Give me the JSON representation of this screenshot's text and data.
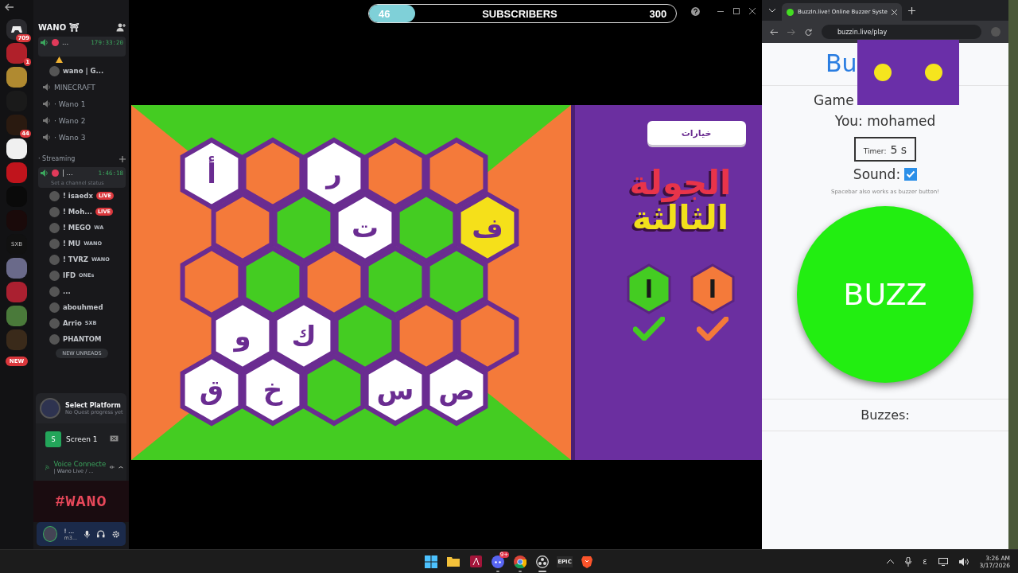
{
  "discord": {
    "rail": [
      {
        "kind": "home",
        "badge": "709"
      },
      {
        "kind": "server",
        "badge": "1"
      },
      {
        "kind": "server"
      },
      {
        "kind": "server"
      },
      {
        "kind": "server",
        "badge": "44"
      },
      {
        "kind": "server"
      },
      {
        "kind": "server"
      },
      {
        "kind": "server"
      },
      {
        "kind": "server"
      },
      {
        "kind": "server",
        "label": "SXB"
      },
      {
        "kind": "server"
      },
      {
        "kind": "server"
      },
      {
        "kind": "server"
      },
      {
        "kind": "server"
      }
    ],
    "new_pill": "NEW",
    "server_name": "WANO ⛩",
    "rows": [
      {
        "kind": "voice-active",
        "name": "...",
        "time": "179:33:20"
      },
      {
        "kind": "alert"
      },
      {
        "kind": "member",
        "name": "wano | G..."
      },
      {
        "kind": "voice",
        "name": "MINECRAFT"
      },
      {
        "kind": "voice",
        "name": "· Wano 1"
      },
      {
        "kind": "voice",
        "name": "· Wano 2"
      },
      {
        "kind": "voice",
        "name": "· Wano 3"
      },
      {
        "kind": "category",
        "name": "· Streaming"
      },
      {
        "kind": "voice-active",
        "name": "| ...",
        "time": "1:46:18",
        "status": "Set a channel status"
      },
      {
        "kind": "member",
        "name": "! isaedx",
        "badge": "LIVE"
      },
      {
        "kind": "member",
        "name": "! Moh...",
        "badge": "LIVE"
      },
      {
        "kind": "member",
        "name": "! MEGO",
        "tag": "WA"
      },
      {
        "kind": "member",
        "name": "! MU",
        "tag": "WANO"
      },
      {
        "kind": "member",
        "name": "! TVRZ",
        "tag": "WANO"
      },
      {
        "kind": "member",
        "name": "IFD",
        "tag": "ONEs"
      },
      {
        "kind": "member",
        "name": "..."
      },
      {
        "kind": "member",
        "name": "abouhmed"
      },
      {
        "kind": "member",
        "name": "Arrio",
        "tag": "SXB"
      },
      {
        "kind": "member",
        "name": "PHANTOM"
      }
    ],
    "unreads": "NEW UNREADS",
    "quest": {
      "title": "Select Platform",
      "subtitle": "No Quest progress yet"
    },
    "screen": {
      "icon_letter": "S",
      "name": "Screen 1"
    },
    "voice": {
      "status": "Voice Connecte",
      "channel": "| Wano Live / ..."
    },
    "banner": "#WANO",
    "user": {
      "name": "! ...",
      "tag": "m3..."
    }
  },
  "subscribers": {
    "current": "46",
    "label": "SUBSCRIBERS",
    "goal": "300",
    "level": 0.15
  },
  "board": {
    "rows": [
      {
        "cells": [
          {
            "color": "#ffffff",
            "letter": "أ"
          },
          {
            "color": "#f47a3a"
          },
          {
            "color": "#ffffff",
            "letter": "ر"
          },
          {
            "color": "#f47a3a"
          },
          {
            "color": "#f47a3a"
          }
        ]
      },
      {
        "cells": [
          {
            "color": "#f47a3a"
          },
          {
            "color": "#44cc22"
          },
          {
            "color": "#ffffff",
            "letter": "ت"
          },
          {
            "color": "#44cc22"
          },
          {
            "color": "#f5e01a",
            "letter": "ف"
          }
        ]
      },
      {
        "cells": [
          {
            "color": "#f47a3a"
          },
          {
            "color": "#44cc22"
          },
          {
            "color": "#f47a3a"
          },
          {
            "color": "#44cc22"
          },
          {
            "color": "#44cc22"
          }
        ]
      },
      {
        "cells": [
          {
            "color": "#ffffff",
            "letter": "و"
          },
          {
            "color": "#ffffff",
            "letter": "ك"
          },
          {
            "color": "#44cc22"
          },
          {
            "color": "#f47a3a"
          },
          {
            "color": "#f47a3a"
          }
        ]
      },
      {
        "cells": [
          {
            "color": "#ffffff",
            "letter": "ق"
          },
          {
            "color": "#ffffff",
            "letter": "خ"
          },
          {
            "color": "#44cc22"
          },
          {
            "color": "#ffffff",
            "letter": "س"
          },
          {
            "color": "#ffffff",
            "letter": "ص"
          }
        ]
      }
    ]
  },
  "panel": {
    "options_button": "خيارات",
    "round_title": [
      "الجولة",
      "الثالثة"
    ],
    "teams": [
      {
        "color": "#f47a3a",
        "letter": "ا"
      },
      {
        "color": "#44cc22",
        "letter": "ا"
      }
    ]
  },
  "browser": {
    "tab_title": "BuzzIn.live! Online Buzzer Syste",
    "url": "buzzin.live/play",
    "heading": "Bu",
    "game_label": "Game",
    "you": "You: mohamed",
    "timer_label": "Timer:",
    "timer_value": "5 s",
    "sound_label": "Sound:",
    "sound_checked": true,
    "hint": "Spacebar also works as buzzer button!",
    "buzz": "BUZZ",
    "buzzes": "Buzzes:"
  },
  "taskbar": {
    "apps": [
      {
        "kind": "start"
      },
      {
        "kind": "files"
      },
      {
        "kind": "affinity"
      },
      {
        "kind": "discord",
        "badge": "9+",
        "running": true,
        "active": false
      },
      {
        "kind": "chrome",
        "running": true,
        "active": false
      },
      {
        "kind": "obs",
        "running": true,
        "active": true
      },
      {
        "kind": "epic",
        "label": "EPIC"
      },
      {
        "kind": "brave"
      }
    ],
    "language": "ε",
    "time": "3:26 AM",
    "date": "3/17/2026"
  }
}
